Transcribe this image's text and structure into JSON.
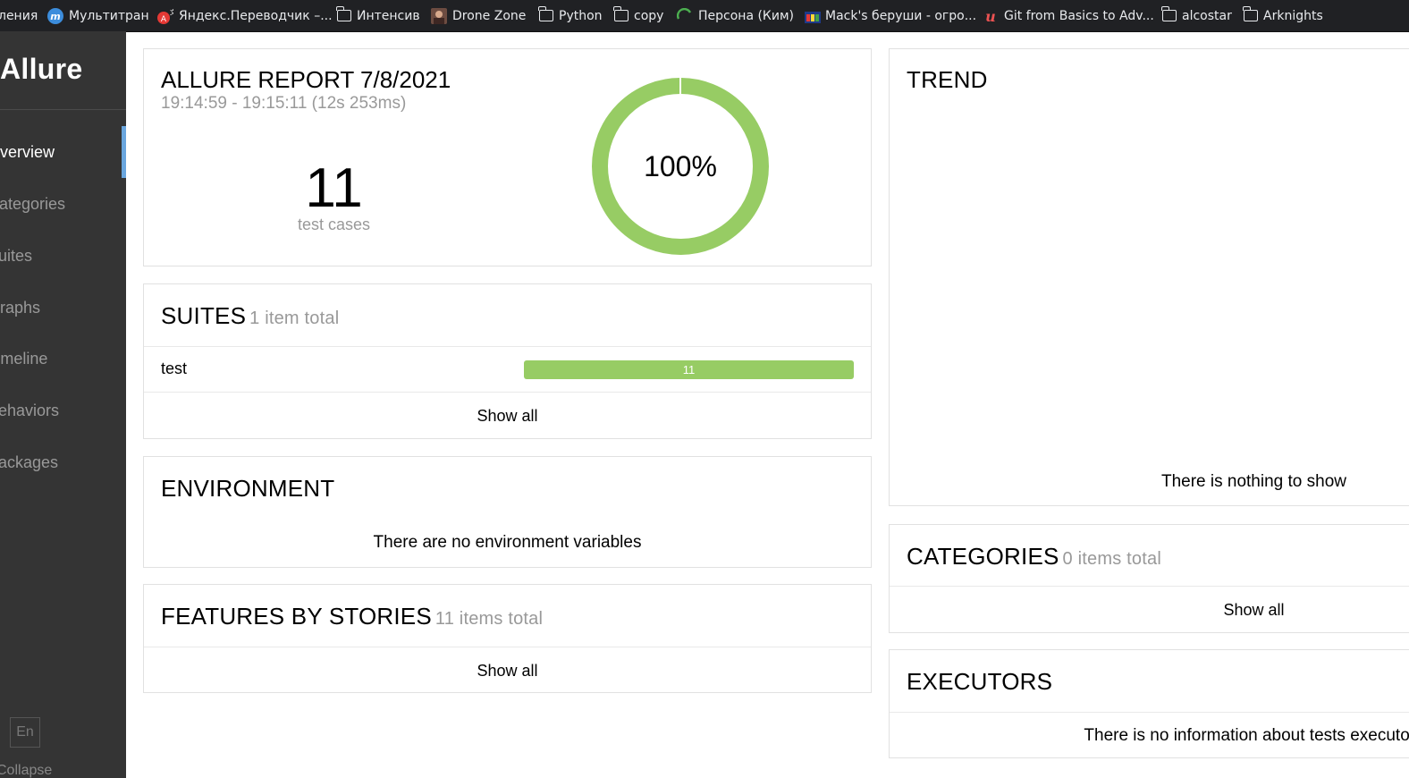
{
  "bookmarks": [
    {
      "label": "ления",
      "icon": "none"
    },
    {
      "label": "Мультитран",
      "icon": "multitran-icon"
    },
    {
      "label": "Яндекс.Переводчик –...",
      "icon": "yandex-translate-icon"
    },
    {
      "label": "Интенсив",
      "icon": "folder-icon"
    },
    {
      "label": "Drone Zone",
      "icon": "drone-zone-icon"
    },
    {
      "label": "Python",
      "icon": "folder-icon"
    },
    {
      "label": "copy",
      "icon": "folder-icon"
    },
    {
      "label": "Персона (Ким)",
      "icon": "loading-icon"
    },
    {
      "label": "Mack's беруши - огро...",
      "icon": "mack-icon"
    },
    {
      "label": "Git from Basics to Adv...",
      "icon": "udemy-icon"
    },
    {
      "label": "alcostar",
      "icon": "folder-icon"
    },
    {
      "label": "Arknights",
      "icon": "folder-icon"
    }
  ],
  "sidebar": {
    "brand": "Allure",
    "items": [
      {
        "label": "Overview",
        "active": true
      },
      {
        "label": "Categories",
        "active": false
      },
      {
        "label": "Suites",
        "active": false
      },
      {
        "label": "Graphs",
        "active": false
      },
      {
        "label": "Timeline",
        "active": false
      },
      {
        "label": "Behaviors",
        "active": false
      },
      {
        "label": "Packages",
        "active": false
      }
    ],
    "lang": "En",
    "collapse": "Collapse"
  },
  "summary": {
    "title": "ALLURE REPORT 7/8/2021",
    "time": "19:14:59 - 19:15:11 (12s 253ms)",
    "count": "11",
    "count_label": "test cases",
    "percent": "100%",
    "passed_fraction": 1.0,
    "color": "#97cc64"
  },
  "suites": {
    "title": "SUITES",
    "subtitle": "1 item total",
    "rows": [
      {
        "name": "test",
        "passed": "11"
      }
    ],
    "show_all": "Show all"
  },
  "environment": {
    "title": "ENVIRONMENT",
    "empty": "There are no environment variables"
  },
  "features": {
    "title": "FEATURES BY STORIES",
    "subtitle": "11 items total",
    "show_all": "Show all"
  },
  "trend": {
    "title": "TREND",
    "empty": "There is nothing to show"
  },
  "categories": {
    "title": "CATEGORIES",
    "subtitle": "0 items total",
    "show_all": "Show all"
  },
  "executors": {
    "title": "EXECUTORS",
    "empty": "There is no information about tests executors"
  }
}
